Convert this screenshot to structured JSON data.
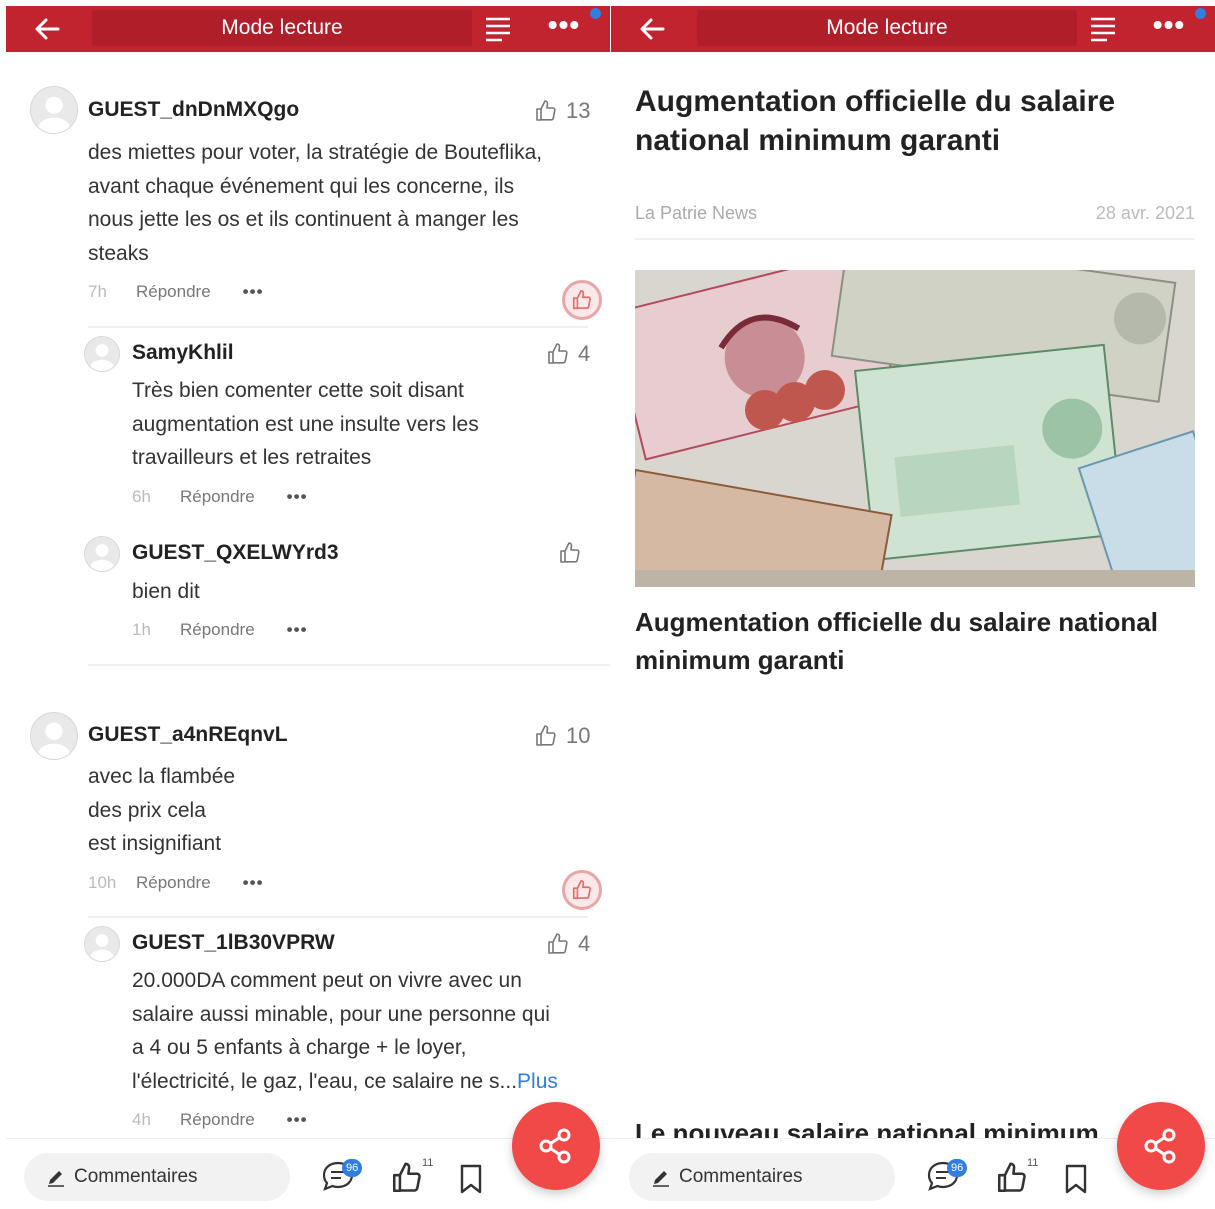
{
  "left": {
    "header": {
      "title": "Mode lecture"
    },
    "comments": [
      {
        "user": "GUEST_dnDnMXQgo",
        "likes": "13",
        "lines": [
          "des miettes pour voter, la stratégie de Bouteflika,",
          "avant chaque événement qui les concerne, ils",
          "nous jette les os et ils continuent à manger les",
          "steaks"
        ],
        "time": "7h",
        "reply": "Répondre",
        "more": "•••",
        "replies": [
          {
            "user": "SamyKhlil",
            "likes": "4",
            "lines": [
              "Très bien comenter cette soit disant",
              "augmentation est une insulte vers les",
              "travailleurs et les retraites"
            ],
            "time": "6h",
            "reply": "Répondre",
            "more": "•••"
          },
          {
            "user": "GUEST_QXELWYrd3",
            "likes": "",
            "lines": [
              "bien dit"
            ],
            "time": "1h",
            "reply": "Répondre",
            "more": "•••"
          }
        ]
      },
      {
        "user": "GUEST_a4nREqnvL",
        "likes": "10",
        "lines": [
          "avec la flambée",
          "des prix cela",
          "est insignifiant"
        ],
        "time": "10h",
        "reply": "Répondre",
        "more": "•••",
        "replies": [
          {
            "user": "GUEST_1lB30VPRW",
            "likes": "4",
            "lines": [
              "20.000DA comment peut on vivre avec un",
              "salaire aussi minable, pour une personne qui",
              "a 4 ou 5 enfants à charge + le loyer,",
              "l'électricité,  le gaz, l'eau, ce salaire ne s..."
            ],
            "more_link": "Plus",
            "time": "4h",
            "reply": "Répondre",
            "more": "•••"
          }
        ]
      }
    ],
    "bottom": {
      "comments_label": "Commentaires",
      "comment_count": "96",
      "like_count": "11"
    }
  },
  "right": {
    "header": {
      "title": "Mode lecture"
    },
    "article": {
      "title": "Augmentation officielle du salaire national minimum garanti",
      "source": "La Patrie News",
      "date": "28 avr. 2021",
      "caption": "Augmentation officielle du salaire national minimum garanti",
      "body_start": "Le nouveau salaire national minimum"
    },
    "bottom": {
      "comments_label": "Commentaires",
      "comment_count": "96",
      "like_count": "11"
    }
  },
  "colors": {
    "header": "#c1242f",
    "accent": "#2f7ee0",
    "share": "#f14848"
  }
}
